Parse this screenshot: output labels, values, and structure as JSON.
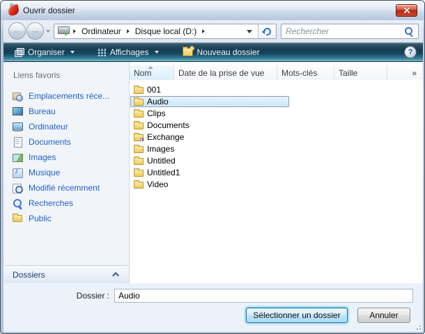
{
  "window": {
    "title": "Ouvrir dossier"
  },
  "icons": {
    "back_glyph": "←",
    "forward_glyph": "→",
    "help_glyph": "?"
  },
  "navbar": {
    "breadcrumb": {
      "items": [
        "Ordinateur",
        "Disque local (D:)"
      ]
    },
    "search_placeholder": "Rechercher"
  },
  "toolbar": {
    "organize_label": "Organiser",
    "views_label": "Affichages",
    "new_folder_label": "Nouveau dossier"
  },
  "sidebar": {
    "header": "Liens favoris",
    "items": [
      {
        "label": "Emplacements réce...",
        "icon": "recent-places-icon"
      },
      {
        "label": "Bureau",
        "icon": "desktop-icon"
      },
      {
        "label": "Ordinateur",
        "icon": "computer-icon"
      },
      {
        "label": "Documents",
        "icon": "documents-icon"
      },
      {
        "label": "Images",
        "icon": "images-icon"
      },
      {
        "label": "Musique",
        "icon": "music-icon"
      },
      {
        "label": "Modifié récemment",
        "icon": "recently-modified-icon"
      },
      {
        "label": "Recherches",
        "icon": "searches-icon"
      },
      {
        "label": "Public",
        "icon": "public-folder-icon"
      }
    ],
    "footer_label": "Dossiers"
  },
  "filelist": {
    "columns": [
      "Nom",
      "Date de la prise de vue",
      "Mots-clés",
      "Taille",
      "»"
    ],
    "sort_column": "Nom",
    "sort_direction": "ascending",
    "rows": [
      {
        "name": "001",
        "icon": "folder-icon"
      },
      {
        "name": "Audio",
        "icon": "folder-icon"
      },
      {
        "name": "Clips",
        "icon": "folder-icon"
      },
      {
        "name": "Documents",
        "icon": "folder-icon"
      },
      {
        "name": "Exchange",
        "icon": "exchange-folder-icon"
      },
      {
        "name": "Images",
        "icon": "folder-icon"
      },
      {
        "name": "Untitled",
        "icon": "folder-icon"
      },
      {
        "name": "Untitled1",
        "icon": "folder-icon"
      },
      {
        "name": "Video",
        "icon": "folder-icon"
      }
    ],
    "selected_row": "Audio"
  },
  "footer": {
    "folder_label": "Dossier :",
    "folder_value": "Audio",
    "select_label": "Sélectionner un dossier",
    "cancel_label": "Annuler"
  },
  "colors": {
    "titlebar": "#c6d4e8",
    "toolbar_top": "#173d52",
    "toolbar_bottom": "#64aab9",
    "selection_fill": "#cde7f8",
    "link_blue": "#2160c4",
    "close_button_red": "#c64a2c",
    "default_button_glow": "#5ec5ee"
  }
}
